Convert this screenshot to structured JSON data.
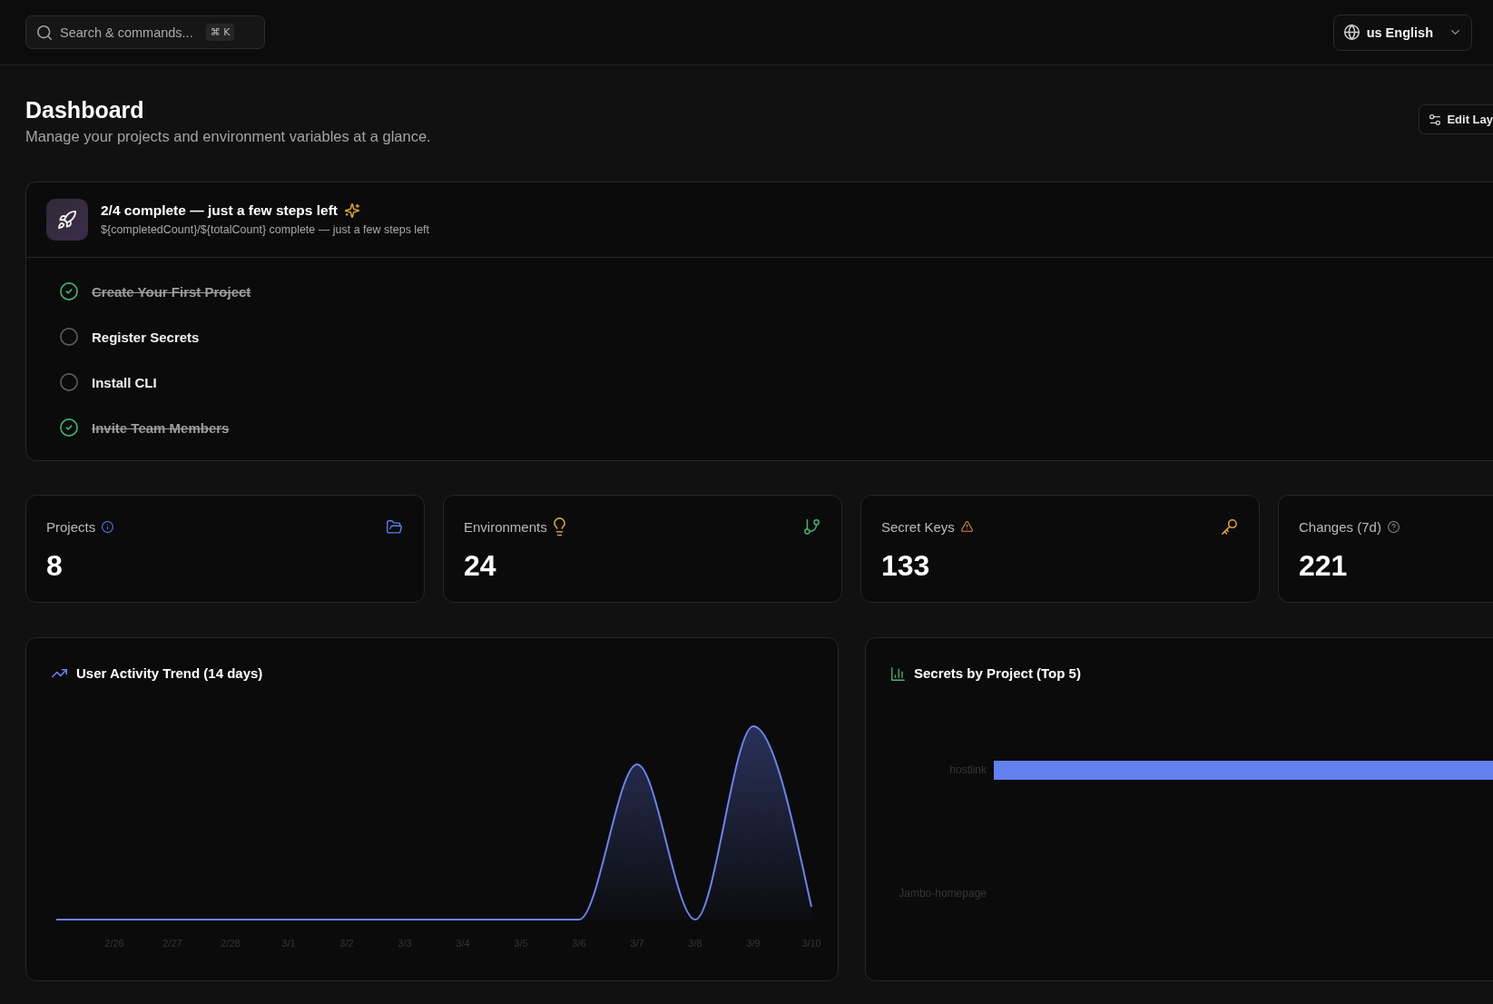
{
  "topbar": {
    "search": {
      "label": "Search & commands...",
      "shortcut": "⌘ K"
    },
    "language": {
      "label": "us English"
    }
  },
  "header": {
    "title": "Dashboard",
    "subtitle": "Manage your projects and environment variables at a glance.",
    "edit_button": "Edit Lay"
  },
  "onboarding": {
    "title": "2/4 complete — just a few steps left",
    "subtitle": "${completedCount}/${totalCount} complete — just a few steps left",
    "steps": [
      {
        "label": "Create Your First Project",
        "checked": true
      },
      {
        "label": "Register Secrets",
        "checked": false
      },
      {
        "label": "Install CLI",
        "checked": false
      },
      {
        "label": "Invite Team Members",
        "checked": true
      }
    ]
  },
  "stats": [
    {
      "kind": "projects",
      "label": "Projects",
      "value": "8"
    },
    {
      "kind": "environments",
      "label": "Environments",
      "value": "24"
    },
    {
      "kind": "secrets",
      "label": "Secret Keys",
      "value": "133"
    },
    {
      "kind": "changes",
      "label": "Changes (7d)",
      "value": "221"
    }
  ],
  "activity_chart": {
    "title": "User Activity Trend (14 days)",
    "x_labels": [
      "2/26",
      "2/27",
      "2/28",
      "3/1",
      "3/2",
      "3/3",
      "3/4",
      "3/5",
      "3/6",
      "3/7",
      "3/8",
      "3/9",
      "3/10"
    ]
  },
  "secrets_chart": {
    "title": "Secrets by Project (Top 5)",
    "bar_labels": [
      "hostlink",
      "Jambo-homepage"
    ]
  }
}
